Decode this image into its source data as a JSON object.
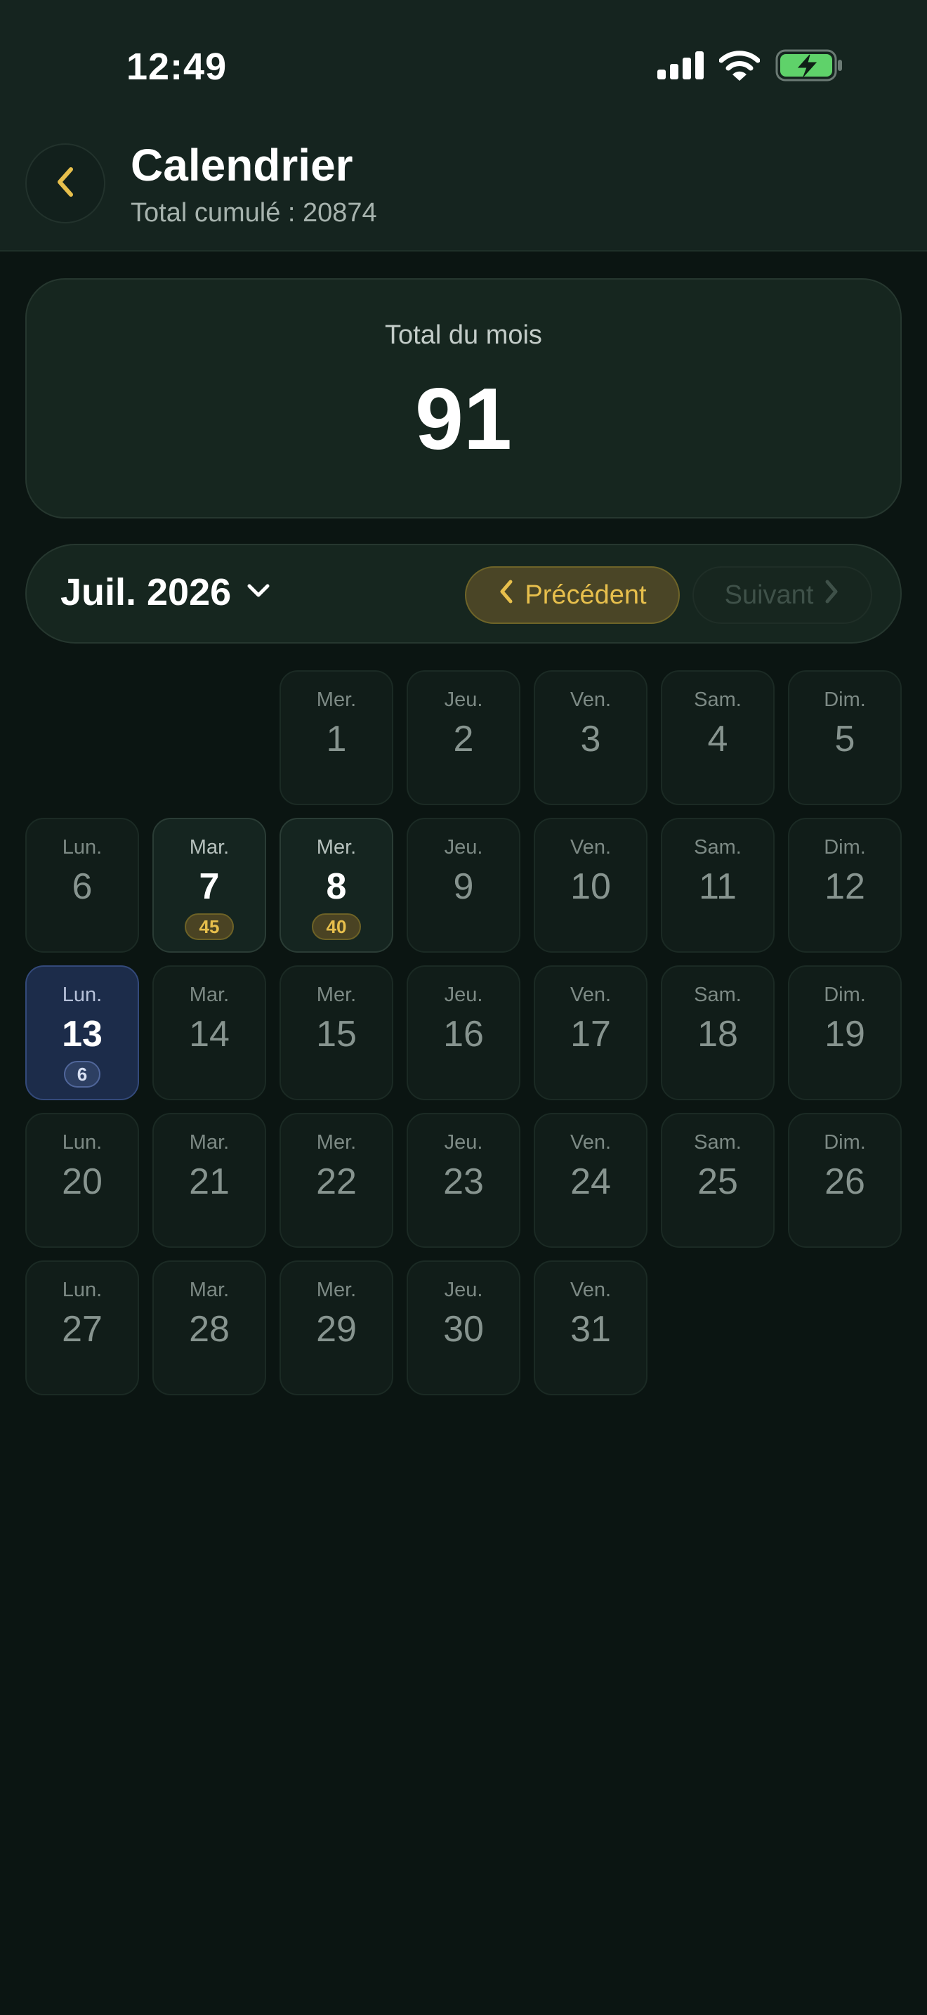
{
  "status_bar": {
    "time": "12:49",
    "icons": [
      "cellular-signal-icon",
      "wifi-icon",
      "battery-charging-icon"
    ]
  },
  "header": {
    "title": "Calendrier",
    "subtitle": "Total cumulé : 20874",
    "back_icon": "chevron-left-icon"
  },
  "month_total": {
    "label": "Total du mois",
    "value": "91"
  },
  "month_nav": {
    "month": "Juil. 2026",
    "dropdown_icon": "chevron-down-icon",
    "prev_label": "Précédent",
    "next_label": "Suivant"
  },
  "colors": {
    "accent_gold": "#e7bf4c",
    "today_blue": "#1c2c4a",
    "background": "#0b1512",
    "battery_green": "#5fd26a"
  },
  "calendar": {
    "leading_empty": 2,
    "days": [
      {
        "dow": "Mer.",
        "num": "1"
      },
      {
        "dow": "Jeu.",
        "num": "2"
      },
      {
        "dow": "Ven.",
        "num": "3"
      },
      {
        "dow": "Sam.",
        "num": "4"
      },
      {
        "dow": "Dim.",
        "num": "5"
      },
      {
        "dow": "Lun.",
        "num": "6"
      },
      {
        "dow": "Mar.",
        "num": "7",
        "value": "45"
      },
      {
        "dow": "Mer.",
        "num": "8",
        "value": "40"
      },
      {
        "dow": "Jeu.",
        "num": "9"
      },
      {
        "dow": "Ven.",
        "num": "10"
      },
      {
        "dow": "Sam.",
        "num": "11"
      },
      {
        "dow": "Dim.",
        "num": "12"
      },
      {
        "dow": "Lun.",
        "num": "13",
        "value": "6",
        "today": true
      },
      {
        "dow": "Mar.",
        "num": "14"
      },
      {
        "dow": "Mer.",
        "num": "15"
      },
      {
        "dow": "Jeu.",
        "num": "16"
      },
      {
        "dow": "Ven.",
        "num": "17"
      },
      {
        "dow": "Sam.",
        "num": "18"
      },
      {
        "dow": "Dim.",
        "num": "19"
      },
      {
        "dow": "Lun.",
        "num": "20"
      },
      {
        "dow": "Mar.",
        "num": "21"
      },
      {
        "dow": "Mer.",
        "num": "22"
      },
      {
        "dow": "Jeu.",
        "num": "23"
      },
      {
        "dow": "Ven.",
        "num": "24"
      },
      {
        "dow": "Sam.",
        "num": "25"
      },
      {
        "dow": "Dim.",
        "num": "26"
      },
      {
        "dow": "Lun.",
        "num": "27"
      },
      {
        "dow": "Mar.",
        "num": "28"
      },
      {
        "dow": "Mer.",
        "num": "29"
      },
      {
        "dow": "Jeu.",
        "num": "30"
      },
      {
        "dow": "Ven.",
        "num": "31"
      }
    ]
  }
}
